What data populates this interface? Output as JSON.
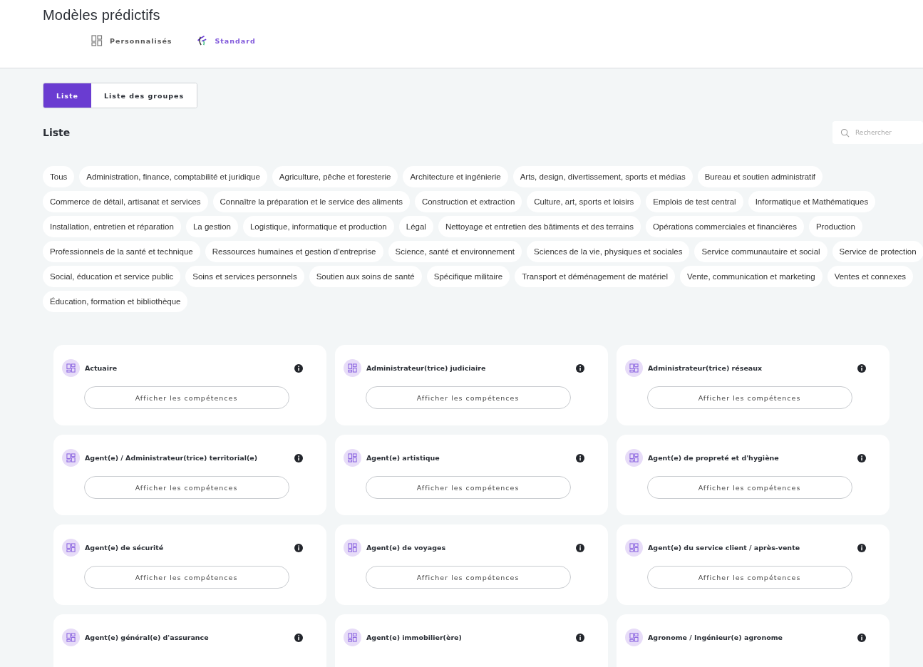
{
  "page_title": "Modèles prédictifs",
  "view_tabs": [
    {
      "label": "Personnalisés",
      "kind": "grid",
      "selected": false
    },
    {
      "label": "Standard",
      "kind": "logo",
      "selected": true
    }
  ],
  "segments": [
    {
      "label": "Liste",
      "selected": true
    },
    {
      "label": "Liste des groupes",
      "selected": false
    }
  ],
  "section_title": "Liste",
  "search": {
    "placeholder": "Rechercher"
  },
  "filters": [
    "Tous",
    "Administration, finance, comptabilité et juridique",
    "Agriculture, pêche et foresterie",
    "Architecture et ingénierie",
    "Arts, design, divertissement, sports et médias",
    "Bureau et soutien administratif",
    "Commerce de détail, artisanat et services",
    "Connaître la préparation et le service des aliments",
    "Construction et extraction",
    "Culture, art, sports et loisirs",
    "Emplois de test central",
    "Informatique et Mathématiques",
    "Installation, entretien et réparation",
    "La gestion",
    "Logistique, informatique et production",
    "Légal",
    "Nettoyage et entretien des bâtiments et des terrains",
    "Opérations commerciales et financières",
    "Production",
    "Professionnels de la santé et technique",
    "Ressources humaines et gestion d'entreprise",
    "Science, santé et environnement",
    "Sciences de la vie, physiques et sociales",
    "Service communautaire et social",
    "Service de protection",
    "Social, éducation et service public",
    "Soins et services personnels",
    "Soutien aux soins de santé",
    "Spécifique militaire",
    "Transport et déménagement de matériel",
    "Vente, communication et marketing",
    "Ventes et connexes",
    "Éducation, formation et bibliothèque"
  ],
  "cards": [
    {
      "title": "Actuaire",
      "button": "Afficher les compétences"
    },
    {
      "title": "Administrateur(trice) judiciaire",
      "button": "Afficher les compétences"
    },
    {
      "title": "Administrateur(trice) réseaux",
      "button": "Afficher les compétences"
    },
    {
      "title": "Agent(e) / Administrateur(trice) territorial(e)",
      "button": "Afficher les compétences"
    },
    {
      "title": "Agent(e) artistique",
      "button": "Afficher les compétences"
    },
    {
      "title": "Agent(e) de propreté et d'hygiène",
      "button": "Afficher les compétences"
    },
    {
      "title": "Agent(e) de sécurité",
      "button": "Afficher les compétences"
    },
    {
      "title": "Agent(e) de voyages",
      "button": "Afficher les compétences"
    },
    {
      "title": "Agent(e) du service client / après-vente",
      "button": "Afficher les compétences"
    },
    {
      "title": "Agent(e) général(e) d'assurance"
    },
    {
      "title": "Agent(e) immobilier(ère)"
    },
    {
      "title": "Agronome / Ingénieur(e) agronome"
    }
  ]
}
